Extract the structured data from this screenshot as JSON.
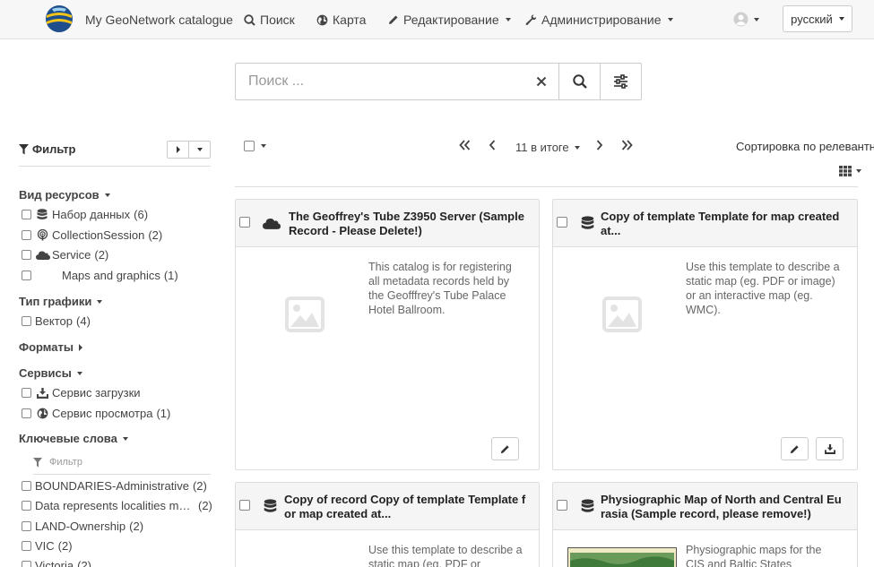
{
  "navbar": {
    "brand": "My GeoNetwork catalogue",
    "search": "Поиск",
    "map": "Карта",
    "editing": "Редактирование",
    "admin": "Администрирование",
    "language": "русский"
  },
  "search": {
    "placeholder": "Поиск ..."
  },
  "sidebar": {
    "filter_title": "Фильтр",
    "facets": {
      "resource_type": {
        "title": "Вид ресурсов",
        "items": [
          {
            "label": "Набор данных",
            "count": "(6)",
            "icon": "database-icon"
          },
          {
            "label": "CollectionSession",
            "count": "(2)",
            "icon": "podcast-icon"
          },
          {
            "label": "Service",
            "count": "(2)",
            "icon": "cloud-icon"
          },
          {
            "label": "Maps and graphics",
            "count": "(1)",
            "icon": ""
          }
        ]
      },
      "graphic_type": {
        "title": "Тип графики",
        "items": [
          {
            "label": "Вектор",
            "count": "(4)"
          }
        ]
      },
      "formats": {
        "title": "Форматы"
      },
      "services": {
        "title": "Сервисы",
        "items": [
          {
            "label": "Сервис загрузки",
            "count": "",
            "icon": "download-icon"
          },
          {
            "label": "Сервис просмотра",
            "count": "(1)",
            "icon": "globe-icon"
          }
        ]
      },
      "keywords": {
        "title": "Ключевые слова",
        "filter_placeholder": "Фильтр",
        "items": [
          {
            "label": "BOUNDARIES-Administrative",
            "count": "(2)"
          },
          {
            "label": "Data represents localities ma…",
            "count": "(2)"
          },
          {
            "label": "LAND-Ownership",
            "count": "(2)"
          },
          {
            "label": "VIC",
            "count": "(2)"
          },
          {
            "label": "Victoria",
            "count": "(2)"
          }
        ]
      }
    }
  },
  "results": {
    "count_label": "11 в итоге",
    "sort_label": "Сортировка по релевантности",
    "cards": [
      {
        "title": "The Geoffrey's Tube Z3950 Server (Sample Record - Please Delete!)",
        "abstract": "This catalog is for registering all metadata records held by the Geofffrey's Tube Palace Hotel Ballroom.",
        "type_icon": "cloud-icon"
      },
      {
        "title": "Copy of template Template for map created at...",
        "abstract": "Use this template to describe a static map (eg. PDF or image) or an interactive map (eg. WMC).",
        "type_icon": "database-icon"
      },
      {
        "title": "Copy of record Copy of template Template f or map created at...",
        "abstract": "Use this template to describe a static map (eg. PDF or",
        "type_icon": "database-icon"
      },
      {
        "title": "Physiographic Map of North and Central Eu rasia (Sample record, please remove!)",
        "abstract": "Physiographic maps for the CIS and Baltic States",
        "type_icon": "database-icon"
      }
    ]
  },
  "colors": {
    "navbar_bg": "#f7f7f7",
    "card_head_bg": "#f5f5f5",
    "text": "#333333",
    "muted": "#666666"
  }
}
